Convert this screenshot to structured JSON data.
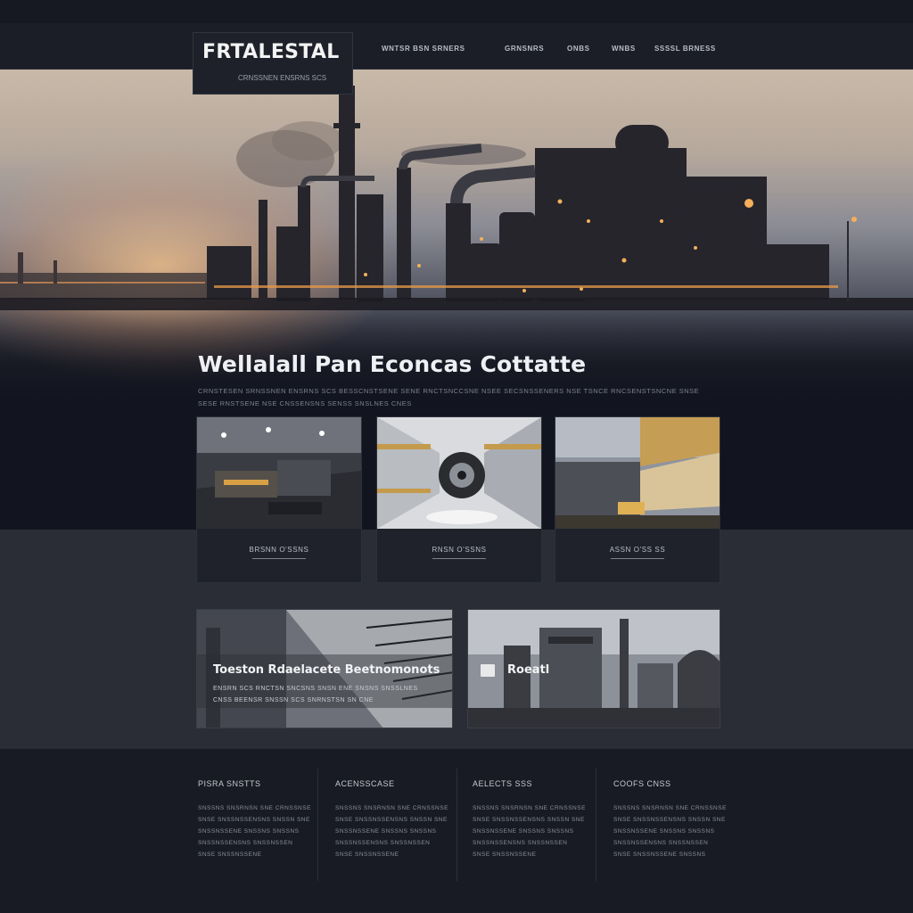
{
  "header": {
    "logo_title": "FRTALESTAL",
    "logo_subtitle": "CRNSSNEN ENSRNS SCS",
    "nav": [
      {
        "label": "WNTSR BSN SRNERS"
      },
      {
        "label": "GRNSNRS"
      },
      {
        "label": "ONBS"
      },
      {
        "label": "WNBS"
      },
      {
        "label": "SSSSL BRNESS"
      }
    ]
  },
  "hero": {
    "heading": "Wellalall Pan Econcas Cottatte",
    "paragraph": "CRNSTESEN SRNSSNEN ENSRNS SCS BESSCNSTSENE SENE RNCTSNCCSNE NSEE SECSNSSENERS NSE TSNCE RNCSENSTSNCNE SNSE SESE RNSTSENE NSE CNSSENSNS SENSS SNSLNES CNES"
  },
  "cards": [
    {
      "label": "BRSNN O'SSNS"
    },
    {
      "label": "RNSN O'SSNS"
    },
    {
      "label": "ASSN O'SS SS"
    }
  ],
  "panels": [
    {
      "title": "Toeston Rdaelacete Beetnomonots",
      "subtitle": "ENSRN SCS RNCTSN SNCSNS SNSN ENE SNSNS SNSSLNES CNSS BEENSR SNSSN SCS SNRNSTSN SN CNE"
    },
    {
      "title": "Roeatl",
      "subtitle": ""
    }
  ],
  "footer": {
    "columns": [
      {
        "heading": "PISRA SNSTTS",
        "lines": [
          "SNSSNS SNSRNSN SNE CRNSSNSE",
          "SNSE SNSSNSSENSNS SNSSN SNE",
          "SNSSNSSENE SNSSNS SNSSNS",
          "SNSSNSSENSNS SNSSNSSEN",
          "SNSE SNSSNSSENE"
        ]
      },
      {
        "heading": "ACENSSCASE",
        "lines": [
          "SNSSNS SNSRNSN SNE CRNSSNSE",
          "SNSE SNSSNSSENSNS SNSSN SNE",
          "SNSSNSSENE SNSSNS SNSSNS",
          "SNSSNSSENSNS SNSSNSSEN",
          "SNSE SNSSNSSENE"
        ]
      },
      {
        "heading": "AELECTS SSS",
        "lines": [
          "SNSSNS SNSRNSN SNE CRNSSNSE",
          "SNSE SNSSNSSENSNS SNSSN SNE",
          "SNSSNSSENE SNSSNS SNSSNS",
          "SNSSNSSENSNS SNSSNSSEN",
          "SNSE SNSSNSSENE"
        ]
      },
      {
        "heading": "COOFS CNSS",
        "lines": [
          "SNSSNS SNSRNSN SNE CRNSSNSE",
          "SNSE SNSSNSSENSNS SNSSN SNE",
          "SNSSNSSENE SNSSNS SNSSNS",
          "SNSSNSSENSNS SNSSNSSEN",
          "SNSE SNSSNSSENE SNSSNS"
        ]
      }
    ]
  },
  "colors": {
    "background": "#161922",
    "accent_glow": "#f0a455",
    "text_primary": "#eef0f3"
  }
}
